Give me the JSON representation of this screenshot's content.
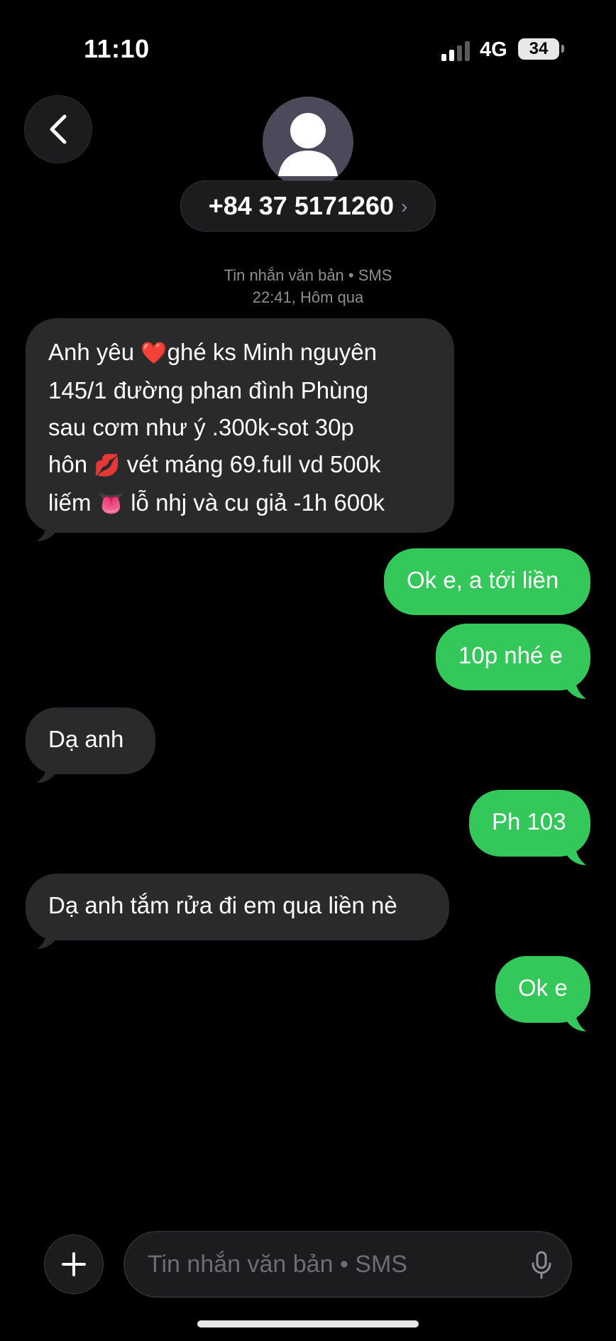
{
  "status": {
    "time": "11:10",
    "network": "4G",
    "battery": "34"
  },
  "header": {
    "contact_number": "+84 37 5171260",
    "chevron": "›"
  },
  "thread": {
    "meta_type": "Tin nhắn văn bản • SMS",
    "meta_time": "22:41, Hôm qua"
  },
  "messages": [
    {
      "direction": "incoming",
      "lines": [
        [
          "Anh yêu ",
          "❤️",
          "ghé ks Minh nguyên"
        ],
        [
          "145/1 đường phan đình Phùng"
        ],
        [
          "sau cơm như ý .300k-sot 30p"
        ],
        [
          "hôn ",
          "💋",
          " vét máng 69.full vd 500k"
        ],
        [
          "liếm ",
          "👅",
          " lỗ nhj và cu giả -1h 600k"
        ]
      ]
    },
    {
      "direction": "outgoing",
      "text": "Ok e, a tới liền"
    },
    {
      "direction": "outgoing",
      "text": "10p nhé e"
    },
    {
      "direction": "incoming",
      "text": "Dạ anh"
    },
    {
      "direction": "outgoing",
      "text": "Ph 103"
    },
    {
      "direction": "incoming",
      "text": "Dạ anh tắm rửa đi em qua liền nè"
    },
    {
      "direction": "outgoing",
      "text": "Ok e"
    }
  ],
  "composer": {
    "placeholder": "Tin nhắn văn bản • SMS"
  },
  "icons": {
    "back": "chevron-left-icon",
    "avatar": "person-icon",
    "plus": "plus-icon",
    "mic": "microphone-icon"
  },
  "colors": {
    "background": "#000000",
    "incoming_bubble": "#2a2a2c",
    "outgoing_bubble": "#34c759",
    "meta_text": "#8e8e93"
  }
}
